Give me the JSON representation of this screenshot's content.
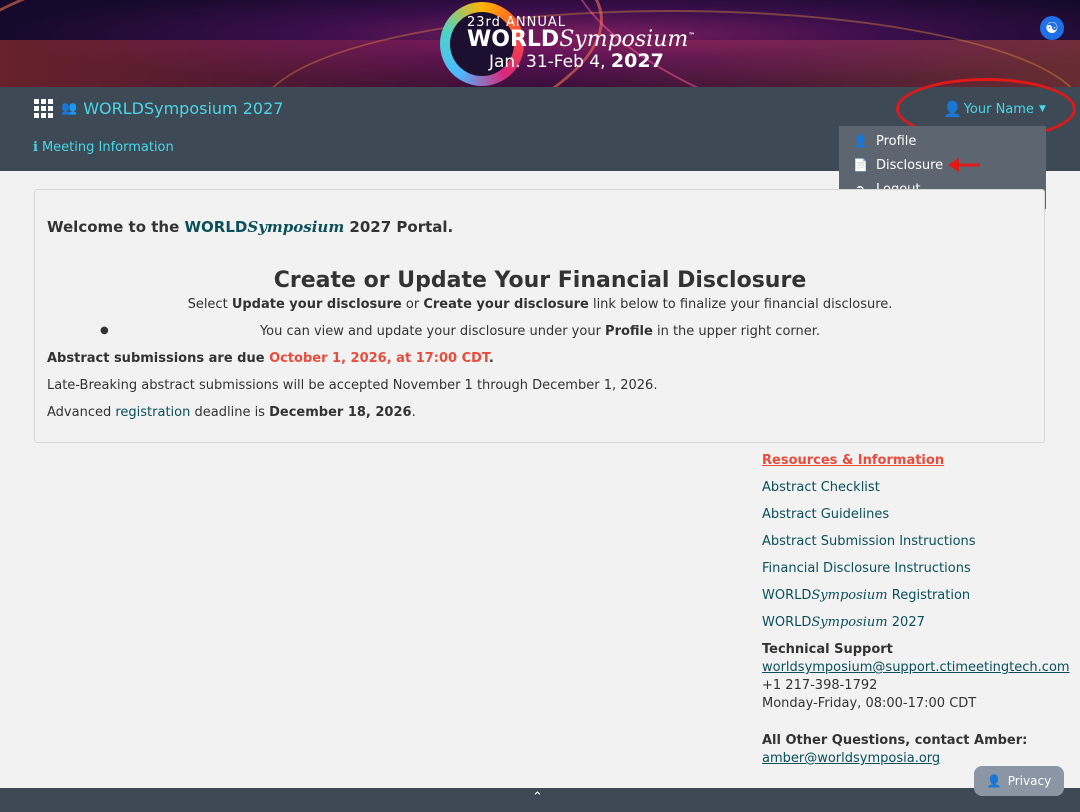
{
  "banner": {
    "annual": "23rd ANNUAL",
    "world": "WORLD",
    "symposium": "Symposium",
    "trademark": "™",
    "dates": "Jan. 31-Feb 4,",
    "year": "2027",
    "accessibility_icon": "accessibility-icon"
  },
  "nav": {
    "brand": "WORLDSymposium 2027",
    "meeting_info": "Meeting Information",
    "user_name": "Your Name",
    "icons": {
      "apps": "grid-icon",
      "users": "users-icon",
      "info": "info-icon",
      "user": "person-icon",
      "caret": "caret-down-icon"
    }
  },
  "dropdown": {
    "items": [
      {
        "label": "Profile",
        "icon": "person-icon"
      },
      {
        "label": "Disclosure",
        "icon": "file-icon"
      },
      {
        "label": "Logout",
        "icon": "sign-out-icon"
      }
    ]
  },
  "annotation_colors": {
    "highlight": "#e01818"
  },
  "main": {
    "welcome_prefix": "Welcome to the ",
    "welcome_world": "WORLD",
    "welcome_symposium": "Symposium",
    "welcome_suffix": " 2027 Portal.",
    "title": "Create or Update Your Financial Disclosure",
    "select_1": "Select ",
    "select_update": "Update your disclosure",
    "select_or": " or ",
    "select_create": "Create your disclosure",
    "select_rest": " link below to finalize your financial disclosure.",
    "view_1": "You can view and update your disclosure under your ",
    "view_profile": "Profile",
    "view_rest": " in the upper right corner.",
    "abstract_label": "Abstract submissions are due ",
    "abstract_date": "October 1, 2026, at 17:00 CDT",
    "abstract_period": ".",
    "late_breaking": "Late-Breaking abstract submissions will be accepted November 1 through December 1, 2026.",
    "advanced_1": "Advanced ",
    "advanced_link": "registration",
    "advanced_2": " deadline is ",
    "advanced_date": "December 18, 2026",
    "advanced_period": "."
  },
  "resources": {
    "heading": "Resources & Information",
    "links": [
      "Abstract Checklist",
      "Abstract Guidelines",
      "Abstract Submission Instructions",
      "Financial Disclosure Instructions"
    ],
    "reg_world": "WORLD",
    "reg_symposium": "Symposium",
    "reg_suffix": " Registration",
    "site_world": "WORLD",
    "site_symposium": "Symposium",
    "site_suffix": " 2027",
    "tech_heading": "Technical Support",
    "tech_email": "worldsymposium@support.ctimeetingtech.com",
    "tech_phone": "+1 217-398-1792",
    "tech_hours": "Monday-Friday, 08:00-17:00 CDT",
    "other_heading": "All Other Questions, contact Amber:",
    "other_email": "amber@worldsymposia.org"
  },
  "footer": {
    "privacy": "Privacy",
    "scroll_up_icon": "chevron-up-icon"
  },
  "colors": {
    "nav_bg": "#3d4a55",
    "accent": "#49d6e6",
    "link": "#0a4f5a",
    "alert": "#e74c3c"
  }
}
